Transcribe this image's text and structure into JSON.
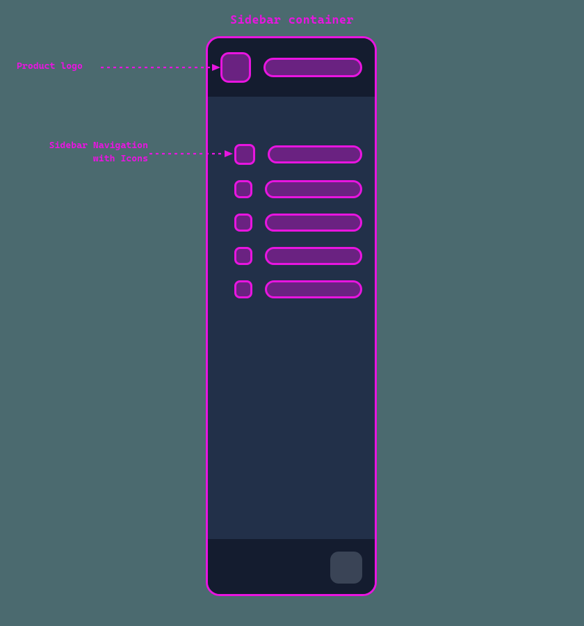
{
  "diagram": {
    "title": "Sidebar container",
    "accent_color": "#e815e0",
    "background_color": "#4b6a6f"
  },
  "annotations": {
    "product_logo": "Product logo",
    "sidebar_nav_line1": "Sidebar Navigation",
    "sidebar_nav_line2": "with Icons"
  },
  "sidebar": {
    "nav_item_count": 5
  }
}
